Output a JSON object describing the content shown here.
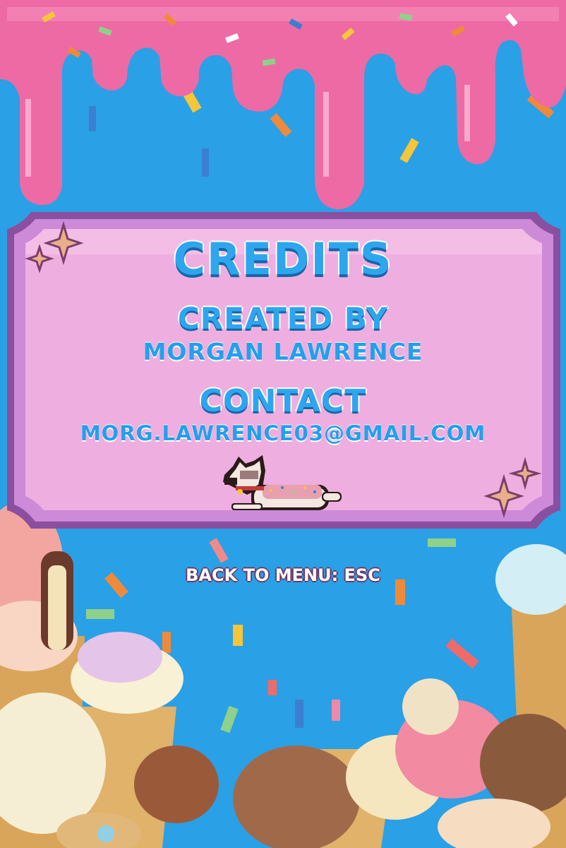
{
  "screen": "credits",
  "title": "CREDITS",
  "created": {
    "label": "CREATED BY",
    "name": "MORGAN LAWRENCE"
  },
  "contact": {
    "label": "CONTACT",
    "email": "MORG.LAWRENCE03@GMAIL.COM"
  },
  "back_hint": "BACK TO MENU: ESC",
  "colors": {
    "background": "#2aa0e6",
    "frosting": "#f06aa6",
    "panel": "#efaee0",
    "panel_border": "#8a4f9e",
    "title_blue": "#2ea6ee"
  },
  "icons": [
    "sparkle-icon",
    "dog-sprite",
    "sprinkle-icon",
    "ice-cream-cone-icon"
  ]
}
